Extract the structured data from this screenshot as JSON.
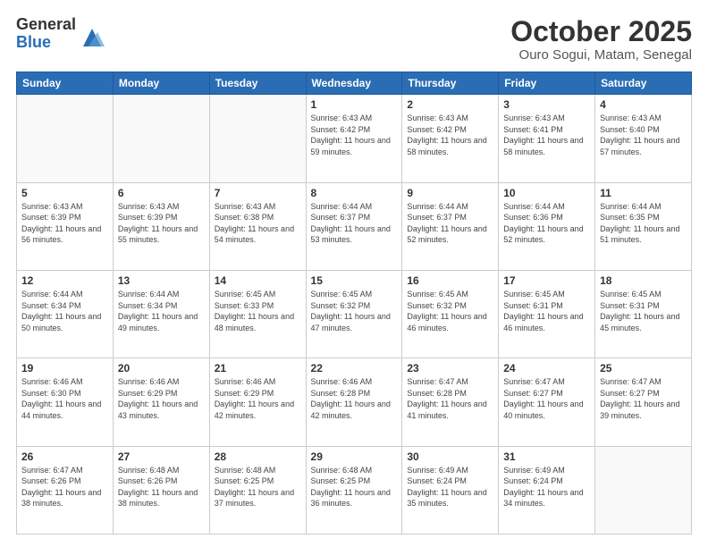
{
  "logo": {
    "general": "General",
    "blue": "Blue"
  },
  "header": {
    "month": "October 2025",
    "location": "Ouro Sogui, Matam, Senegal"
  },
  "days_of_week": [
    "Sunday",
    "Monday",
    "Tuesday",
    "Wednesday",
    "Thursday",
    "Friday",
    "Saturday"
  ],
  "weeks": [
    [
      {
        "day": "",
        "info": ""
      },
      {
        "day": "",
        "info": ""
      },
      {
        "day": "",
        "info": ""
      },
      {
        "day": "1",
        "info": "Sunrise: 6:43 AM\nSunset: 6:42 PM\nDaylight: 11 hours and 59 minutes."
      },
      {
        "day": "2",
        "info": "Sunrise: 6:43 AM\nSunset: 6:42 PM\nDaylight: 11 hours and 58 minutes."
      },
      {
        "day": "3",
        "info": "Sunrise: 6:43 AM\nSunset: 6:41 PM\nDaylight: 11 hours and 58 minutes."
      },
      {
        "day": "4",
        "info": "Sunrise: 6:43 AM\nSunset: 6:40 PM\nDaylight: 11 hours and 57 minutes."
      }
    ],
    [
      {
        "day": "5",
        "info": "Sunrise: 6:43 AM\nSunset: 6:39 PM\nDaylight: 11 hours and 56 minutes."
      },
      {
        "day": "6",
        "info": "Sunrise: 6:43 AM\nSunset: 6:39 PM\nDaylight: 11 hours and 55 minutes."
      },
      {
        "day": "7",
        "info": "Sunrise: 6:43 AM\nSunset: 6:38 PM\nDaylight: 11 hours and 54 minutes."
      },
      {
        "day": "8",
        "info": "Sunrise: 6:44 AM\nSunset: 6:37 PM\nDaylight: 11 hours and 53 minutes."
      },
      {
        "day": "9",
        "info": "Sunrise: 6:44 AM\nSunset: 6:37 PM\nDaylight: 11 hours and 52 minutes."
      },
      {
        "day": "10",
        "info": "Sunrise: 6:44 AM\nSunset: 6:36 PM\nDaylight: 11 hours and 52 minutes."
      },
      {
        "day": "11",
        "info": "Sunrise: 6:44 AM\nSunset: 6:35 PM\nDaylight: 11 hours and 51 minutes."
      }
    ],
    [
      {
        "day": "12",
        "info": "Sunrise: 6:44 AM\nSunset: 6:34 PM\nDaylight: 11 hours and 50 minutes."
      },
      {
        "day": "13",
        "info": "Sunrise: 6:44 AM\nSunset: 6:34 PM\nDaylight: 11 hours and 49 minutes."
      },
      {
        "day": "14",
        "info": "Sunrise: 6:45 AM\nSunset: 6:33 PM\nDaylight: 11 hours and 48 minutes."
      },
      {
        "day": "15",
        "info": "Sunrise: 6:45 AM\nSunset: 6:32 PM\nDaylight: 11 hours and 47 minutes."
      },
      {
        "day": "16",
        "info": "Sunrise: 6:45 AM\nSunset: 6:32 PM\nDaylight: 11 hours and 46 minutes."
      },
      {
        "day": "17",
        "info": "Sunrise: 6:45 AM\nSunset: 6:31 PM\nDaylight: 11 hours and 46 minutes."
      },
      {
        "day": "18",
        "info": "Sunrise: 6:45 AM\nSunset: 6:31 PM\nDaylight: 11 hours and 45 minutes."
      }
    ],
    [
      {
        "day": "19",
        "info": "Sunrise: 6:46 AM\nSunset: 6:30 PM\nDaylight: 11 hours and 44 minutes."
      },
      {
        "day": "20",
        "info": "Sunrise: 6:46 AM\nSunset: 6:29 PM\nDaylight: 11 hours and 43 minutes."
      },
      {
        "day": "21",
        "info": "Sunrise: 6:46 AM\nSunset: 6:29 PM\nDaylight: 11 hours and 42 minutes."
      },
      {
        "day": "22",
        "info": "Sunrise: 6:46 AM\nSunset: 6:28 PM\nDaylight: 11 hours and 42 minutes."
      },
      {
        "day": "23",
        "info": "Sunrise: 6:47 AM\nSunset: 6:28 PM\nDaylight: 11 hours and 41 minutes."
      },
      {
        "day": "24",
        "info": "Sunrise: 6:47 AM\nSunset: 6:27 PM\nDaylight: 11 hours and 40 minutes."
      },
      {
        "day": "25",
        "info": "Sunrise: 6:47 AM\nSunset: 6:27 PM\nDaylight: 11 hours and 39 minutes."
      }
    ],
    [
      {
        "day": "26",
        "info": "Sunrise: 6:47 AM\nSunset: 6:26 PM\nDaylight: 11 hours and 38 minutes."
      },
      {
        "day": "27",
        "info": "Sunrise: 6:48 AM\nSunset: 6:26 PM\nDaylight: 11 hours and 38 minutes."
      },
      {
        "day": "28",
        "info": "Sunrise: 6:48 AM\nSunset: 6:25 PM\nDaylight: 11 hours and 37 minutes."
      },
      {
        "day": "29",
        "info": "Sunrise: 6:48 AM\nSunset: 6:25 PM\nDaylight: 11 hours and 36 minutes."
      },
      {
        "day": "30",
        "info": "Sunrise: 6:49 AM\nSunset: 6:24 PM\nDaylight: 11 hours and 35 minutes."
      },
      {
        "day": "31",
        "info": "Sunrise: 6:49 AM\nSunset: 6:24 PM\nDaylight: 11 hours and 34 minutes."
      },
      {
        "day": "",
        "info": ""
      }
    ]
  ]
}
